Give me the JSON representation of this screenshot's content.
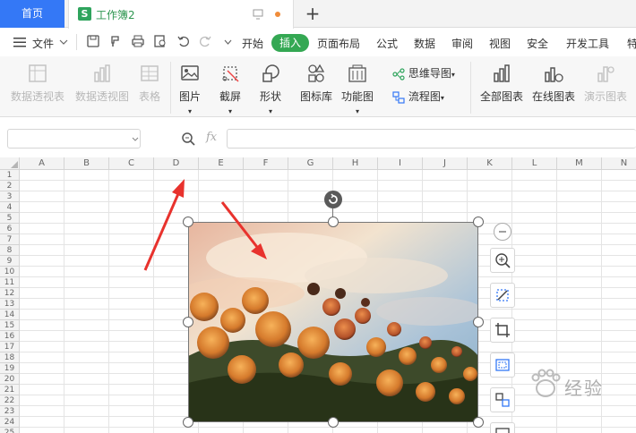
{
  "tabs": {
    "home": "首页",
    "document": "工作簿2",
    "new_tab": "+"
  },
  "menu": {
    "file": "文件",
    "items": [
      "开始",
      "插入",
      "页面布局",
      "公式",
      "数据",
      "审阅",
      "视图",
      "安全",
      "开发工具",
      "特"
    ],
    "active": "插入"
  },
  "ribbon": {
    "pivot_table": "数据透视表",
    "pivot_chart": "数据透视图",
    "table": "表格",
    "picture": "图片",
    "screenshot": "截屏",
    "shapes": "形状",
    "icon_library": "图标库",
    "function_chart": "功能图",
    "mind_map": "思维导图",
    "flowchart": "流程图",
    "all_charts": "全部图表",
    "online_charts": "在线图表",
    "demo_charts": "演示图表"
  },
  "formula_bar": {
    "fx": "fx",
    "name_box": "",
    "formula": ""
  },
  "columns": [
    "A",
    "B",
    "C",
    "D",
    "E",
    "F",
    "G",
    "H",
    "I",
    "J",
    "K",
    "L",
    "M",
    "N"
  ],
  "rows": [
    "1",
    "2",
    "3",
    "4",
    "5",
    "6",
    "7",
    "8",
    "9",
    "10",
    "11",
    "12",
    "13",
    "14",
    "15",
    "16",
    "17",
    "18",
    "19",
    "20",
    "21",
    "22",
    "23",
    "24",
    "25"
  ],
  "watermark": "经验",
  "colors": {
    "accent": "#3478f6",
    "insert_tab": "#34a853",
    "doc_title": "#2e9650",
    "arrow": "#e8322d"
  }
}
